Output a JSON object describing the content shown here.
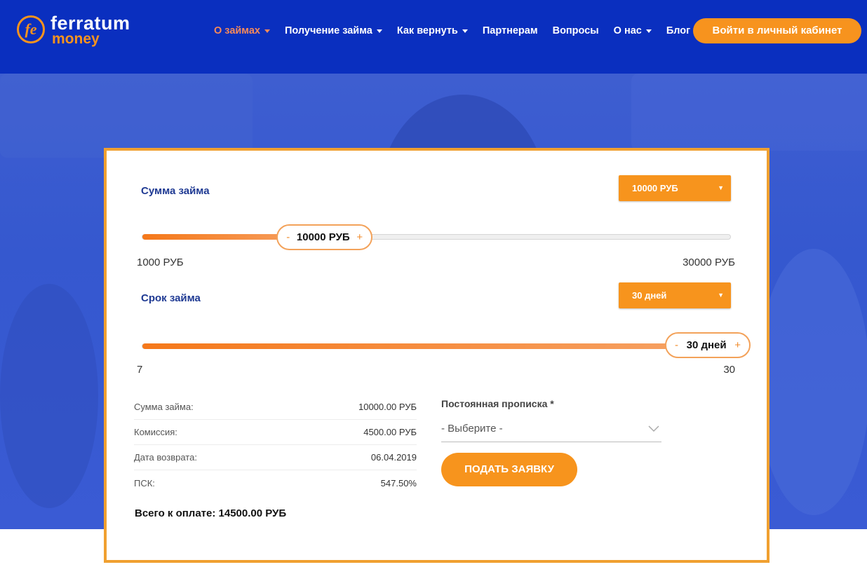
{
  "brand": {
    "word1": "ferratum",
    "word2": "money",
    "mark": "fe"
  },
  "nav": {
    "items": [
      {
        "label": "О займах",
        "dropdown": true,
        "active": true
      },
      {
        "label": "Получение займа",
        "dropdown": true
      },
      {
        "label": "Как вернуть",
        "dropdown": true
      },
      {
        "label": "Партнерам",
        "dropdown": false
      },
      {
        "label": "Вопросы",
        "dropdown": false
      },
      {
        "label": "О нас",
        "dropdown": true
      },
      {
        "label": "Блог",
        "dropdown": false
      }
    ],
    "login_label": "Войти в личный кабинет"
  },
  "calculator": {
    "amount": {
      "label": "Сумма займа",
      "dropdown_value": "10000 РУБ",
      "slider_value": "10000 РУБ",
      "min_label": "1000 РУБ",
      "max_label": "30000 РУБ",
      "min": 1000,
      "max": 30000,
      "value": 10000
    },
    "term": {
      "label": "Срок займа",
      "dropdown_value": "30 дней",
      "slider_value": "30 дней",
      "min_label": "7",
      "max_label": "30",
      "min": 7,
      "max": 30,
      "value": 30
    },
    "minus": "-",
    "plus": "+",
    "summary": [
      {
        "label": "Сумма займа:",
        "value": "10000.00 РУБ"
      },
      {
        "label": "Комиссия:",
        "value": "4500.00 РУБ"
      },
      {
        "label": "Дата возврата:",
        "value": "06.04.2019"
      },
      {
        "label": "ПСК:",
        "value": "547.50%"
      }
    ],
    "total": "Всего к оплате: 14500.00 РУБ",
    "registration_label": "Постоянная прописка *",
    "registration_value": "- Выберите -",
    "submit_label": "ПОДАТЬ ЗАЯВКУ"
  },
  "colors": {
    "header": "#0a2fbf",
    "accent": "#f7931e",
    "label_blue": "#1f3a93"
  }
}
